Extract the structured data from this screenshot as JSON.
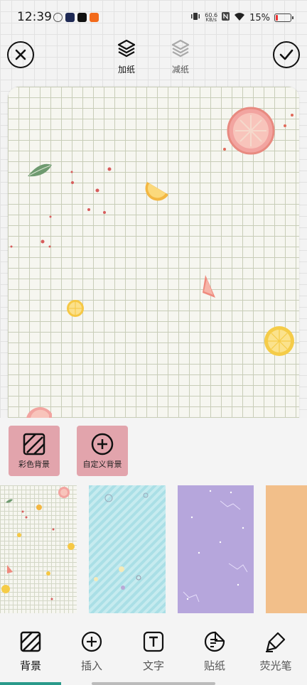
{
  "status_bar": {
    "time": "12:39",
    "net_speed_value": "60.6",
    "net_speed_unit": "KB/s",
    "battery": "15%",
    "battery_level": 0.15
  },
  "toolbar": {
    "close_icon": "close-circle-icon",
    "confirm_icon": "check-circle-icon",
    "add_paper_label": "加纸",
    "remove_paper_label": "减纸"
  },
  "background_options": [
    {
      "label": "彩色背景",
      "icon": "diagonal-stripes-icon"
    },
    {
      "label": "自定义背景",
      "icon": "plus-circle-icon"
    }
  ],
  "thumbnails": [
    "grid-fruit",
    "cyan-stripes",
    "purple-constellation",
    "orange"
  ],
  "bottom_nav": [
    {
      "label": "背景",
      "icon": "diagonal-stripes-icon",
      "active": true
    },
    {
      "label": "插入",
      "icon": "plus-circle-icon"
    },
    {
      "label": "文字",
      "icon": "text-box-icon"
    },
    {
      "label": "贴纸",
      "icon": "sticker-icon"
    },
    {
      "label": "荧光笔",
      "icon": "highlighter-icon"
    }
  ],
  "colors": {
    "accent": "#2a9a8a",
    "option_bg": "#e2a4ac",
    "paper_grid": "#c8cdb8"
  }
}
